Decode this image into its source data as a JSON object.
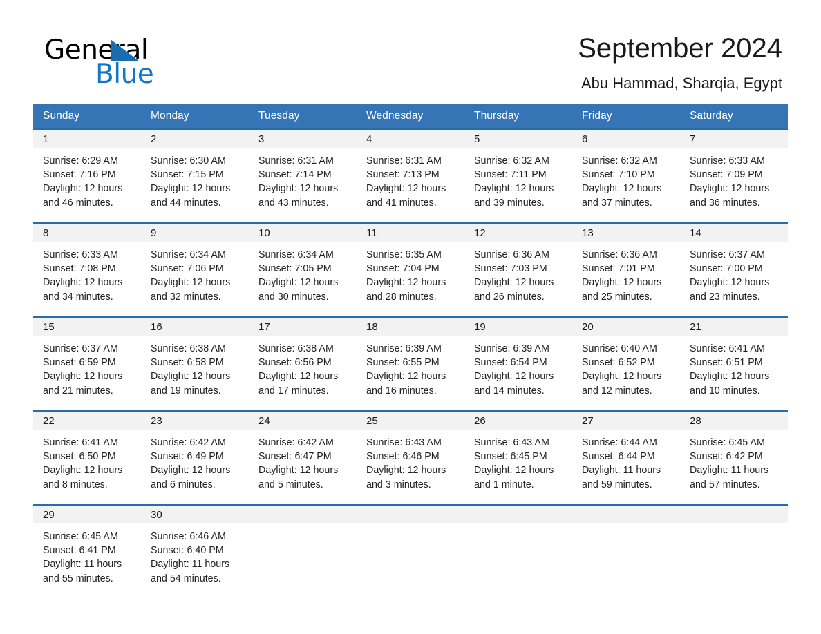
{
  "brand": {
    "word_one": "General",
    "word_two": "Blue",
    "triangle_color": "#1a6cb0",
    "blue_color": "#1377c8"
  },
  "header": {
    "title": "September 2024",
    "location": "Abu Hammad, Sharqia, Egypt"
  },
  "theme": {
    "header_blue": "#3575b5",
    "row_divider_blue": "#2a6ca8",
    "daynum_bg": "#f2f2f2",
    "page_bg": "#ffffff",
    "text": "#1a1a1a"
  },
  "calendar": {
    "weekdays": [
      "Sunday",
      "Monday",
      "Tuesday",
      "Wednesday",
      "Thursday",
      "Friday",
      "Saturday"
    ],
    "weeks": [
      [
        {
          "day": "1",
          "sunrise": "Sunrise: 6:29 AM",
          "sunset": "Sunset: 7:16 PM",
          "daylight_1": "Daylight: 12 hours",
          "daylight_2": "and 46 minutes."
        },
        {
          "day": "2",
          "sunrise": "Sunrise: 6:30 AM",
          "sunset": "Sunset: 7:15 PM",
          "daylight_1": "Daylight: 12 hours",
          "daylight_2": "and 44 minutes."
        },
        {
          "day": "3",
          "sunrise": "Sunrise: 6:31 AM",
          "sunset": "Sunset: 7:14 PM",
          "daylight_1": "Daylight: 12 hours",
          "daylight_2": "and 43 minutes."
        },
        {
          "day": "4",
          "sunrise": "Sunrise: 6:31 AM",
          "sunset": "Sunset: 7:13 PM",
          "daylight_1": "Daylight: 12 hours",
          "daylight_2": "and 41 minutes."
        },
        {
          "day": "5",
          "sunrise": "Sunrise: 6:32 AM",
          "sunset": "Sunset: 7:11 PM",
          "daylight_1": "Daylight: 12 hours",
          "daylight_2": "and 39 minutes."
        },
        {
          "day": "6",
          "sunrise": "Sunrise: 6:32 AM",
          "sunset": "Sunset: 7:10 PM",
          "daylight_1": "Daylight: 12 hours",
          "daylight_2": "and 37 minutes."
        },
        {
          "day": "7",
          "sunrise": "Sunrise: 6:33 AM",
          "sunset": "Sunset: 7:09 PM",
          "daylight_1": "Daylight: 12 hours",
          "daylight_2": "and 36 minutes."
        }
      ],
      [
        {
          "day": "8",
          "sunrise": "Sunrise: 6:33 AM",
          "sunset": "Sunset: 7:08 PM",
          "daylight_1": "Daylight: 12 hours",
          "daylight_2": "and 34 minutes."
        },
        {
          "day": "9",
          "sunrise": "Sunrise: 6:34 AM",
          "sunset": "Sunset: 7:06 PM",
          "daylight_1": "Daylight: 12 hours",
          "daylight_2": "and 32 minutes."
        },
        {
          "day": "10",
          "sunrise": "Sunrise: 6:34 AM",
          "sunset": "Sunset: 7:05 PM",
          "daylight_1": "Daylight: 12 hours",
          "daylight_2": "and 30 minutes."
        },
        {
          "day": "11",
          "sunrise": "Sunrise: 6:35 AM",
          "sunset": "Sunset: 7:04 PM",
          "daylight_1": "Daylight: 12 hours",
          "daylight_2": "and 28 minutes."
        },
        {
          "day": "12",
          "sunrise": "Sunrise: 6:36 AM",
          "sunset": "Sunset: 7:03 PM",
          "daylight_1": "Daylight: 12 hours",
          "daylight_2": "and 26 minutes."
        },
        {
          "day": "13",
          "sunrise": "Sunrise: 6:36 AM",
          "sunset": "Sunset: 7:01 PM",
          "daylight_1": "Daylight: 12 hours",
          "daylight_2": "and 25 minutes."
        },
        {
          "day": "14",
          "sunrise": "Sunrise: 6:37 AM",
          "sunset": "Sunset: 7:00 PM",
          "daylight_1": "Daylight: 12 hours",
          "daylight_2": "and 23 minutes."
        }
      ],
      [
        {
          "day": "15",
          "sunrise": "Sunrise: 6:37 AM",
          "sunset": "Sunset: 6:59 PM",
          "daylight_1": "Daylight: 12 hours",
          "daylight_2": "and 21 minutes."
        },
        {
          "day": "16",
          "sunrise": "Sunrise: 6:38 AM",
          "sunset": "Sunset: 6:58 PM",
          "daylight_1": "Daylight: 12 hours",
          "daylight_2": "and 19 minutes."
        },
        {
          "day": "17",
          "sunrise": "Sunrise: 6:38 AM",
          "sunset": "Sunset: 6:56 PM",
          "daylight_1": "Daylight: 12 hours",
          "daylight_2": "and 17 minutes."
        },
        {
          "day": "18",
          "sunrise": "Sunrise: 6:39 AM",
          "sunset": "Sunset: 6:55 PM",
          "daylight_1": "Daylight: 12 hours",
          "daylight_2": "and 16 minutes."
        },
        {
          "day": "19",
          "sunrise": "Sunrise: 6:39 AM",
          "sunset": "Sunset: 6:54 PM",
          "daylight_1": "Daylight: 12 hours",
          "daylight_2": "and 14 minutes."
        },
        {
          "day": "20",
          "sunrise": "Sunrise: 6:40 AM",
          "sunset": "Sunset: 6:52 PM",
          "daylight_1": "Daylight: 12 hours",
          "daylight_2": "and 12 minutes."
        },
        {
          "day": "21",
          "sunrise": "Sunrise: 6:41 AM",
          "sunset": "Sunset: 6:51 PM",
          "daylight_1": "Daylight: 12 hours",
          "daylight_2": "and 10 minutes."
        }
      ],
      [
        {
          "day": "22",
          "sunrise": "Sunrise: 6:41 AM",
          "sunset": "Sunset: 6:50 PM",
          "daylight_1": "Daylight: 12 hours",
          "daylight_2": "and 8 minutes."
        },
        {
          "day": "23",
          "sunrise": "Sunrise: 6:42 AM",
          "sunset": "Sunset: 6:49 PM",
          "daylight_1": "Daylight: 12 hours",
          "daylight_2": "and 6 minutes."
        },
        {
          "day": "24",
          "sunrise": "Sunrise: 6:42 AM",
          "sunset": "Sunset: 6:47 PM",
          "daylight_1": "Daylight: 12 hours",
          "daylight_2": "and 5 minutes."
        },
        {
          "day": "25",
          "sunrise": "Sunrise: 6:43 AM",
          "sunset": "Sunset: 6:46 PM",
          "daylight_1": "Daylight: 12 hours",
          "daylight_2": "and 3 minutes."
        },
        {
          "day": "26",
          "sunrise": "Sunrise: 6:43 AM",
          "sunset": "Sunset: 6:45 PM",
          "daylight_1": "Daylight: 12 hours",
          "daylight_2": "and 1 minute."
        },
        {
          "day": "27",
          "sunrise": "Sunrise: 6:44 AM",
          "sunset": "Sunset: 6:44 PM",
          "daylight_1": "Daylight: 11 hours",
          "daylight_2": "and 59 minutes."
        },
        {
          "day": "28",
          "sunrise": "Sunrise: 6:45 AM",
          "sunset": "Sunset: 6:42 PM",
          "daylight_1": "Daylight: 11 hours",
          "daylight_2": "and 57 minutes."
        }
      ],
      [
        {
          "day": "29",
          "sunrise": "Sunrise: 6:45 AM",
          "sunset": "Sunset: 6:41 PM",
          "daylight_1": "Daylight: 11 hours",
          "daylight_2": "and 55 minutes."
        },
        {
          "day": "30",
          "sunrise": "Sunrise: 6:46 AM",
          "sunset": "Sunset: 6:40 PM",
          "daylight_1": "Daylight: 11 hours",
          "daylight_2": "and 54 minutes."
        },
        {
          "day": "",
          "sunrise": "",
          "sunset": "",
          "daylight_1": "",
          "daylight_2": ""
        },
        {
          "day": "",
          "sunrise": "",
          "sunset": "",
          "daylight_1": "",
          "daylight_2": ""
        },
        {
          "day": "",
          "sunrise": "",
          "sunset": "",
          "daylight_1": "",
          "daylight_2": ""
        },
        {
          "day": "",
          "sunrise": "",
          "sunset": "",
          "daylight_1": "",
          "daylight_2": ""
        },
        {
          "day": "",
          "sunrise": "",
          "sunset": "",
          "daylight_1": "",
          "daylight_2": ""
        }
      ]
    ]
  }
}
